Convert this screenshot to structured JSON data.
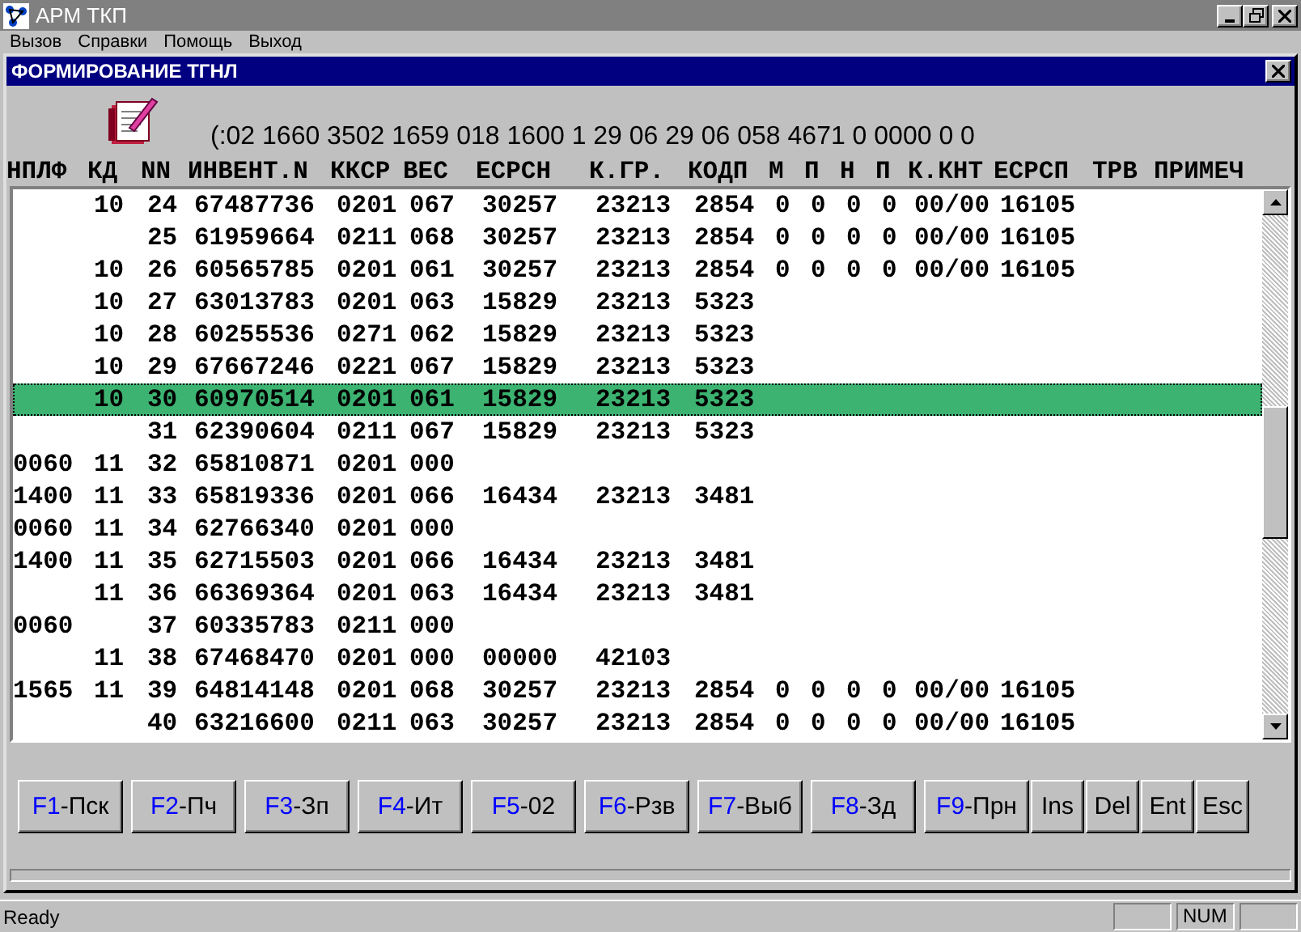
{
  "window": {
    "title": "АРМ ТКП"
  },
  "menu": [
    "Вызов",
    "Справки",
    "Помощь",
    "Выход"
  ],
  "child_window": {
    "title": "ФОРМИРОВАНИЕ ТГНЛ"
  },
  "info_line": "(:02 1660 3502 1659 018 1600 1 29 06 29 06 058 4671 0 0000 0 0",
  "table": {
    "columns": [
      "НПЛФ",
      "КД",
      "NN",
      "ИНВЕНТ.N",
      "ККСР",
      "ВЕС",
      "ЕСРСН",
      "К.ГР.",
      "КОДП",
      "М",
      "П",
      "Н",
      "П",
      "К.КНТ",
      "ЕСРСП",
      "ТРВ",
      "ПРИМЕЧ"
    ],
    "rows": [
      {
        "cells": [
          "",
          "10",
          "24",
          "67487736",
          "0201",
          "067",
          "30257",
          "23213",
          "2854",
          "0",
          "0",
          "0",
          "0",
          "00/00",
          "16105"
        ],
        "selected": false
      },
      {
        "cells": [
          "",
          "",
          "25",
          "61959664",
          "0211",
          "068",
          "30257",
          "23213",
          "2854",
          "0",
          "0",
          "0",
          "0",
          "00/00",
          "16105"
        ],
        "selected": false
      },
      {
        "cells": [
          "",
          "10",
          "26",
          "60565785",
          "0201",
          "061",
          "30257",
          "23213",
          "2854",
          "0",
          "0",
          "0",
          "0",
          "00/00",
          "16105"
        ],
        "selected": false
      },
      {
        "cells": [
          "",
          "10",
          "27",
          "63013783",
          "0201",
          "063",
          "15829",
          "23213",
          "5323"
        ],
        "selected": false
      },
      {
        "cells": [
          "",
          "10",
          "28",
          "60255536",
          "0271",
          "062",
          "15829",
          "23213",
          "5323"
        ],
        "selected": false
      },
      {
        "cells": [
          "",
          "10",
          "29",
          "67667246",
          "0221",
          "067",
          "15829",
          "23213",
          "5323"
        ],
        "selected": false
      },
      {
        "cells": [
          "",
          "10",
          "30",
          "60970514",
          "0201",
          "061",
          "15829",
          "23213",
          "5323"
        ],
        "selected": true
      },
      {
        "cells": [
          "",
          "",
          "31",
          "62390604",
          "0211",
          "067",
          "15829",
          "23213",
          "5323"
        ],
        "selected": false
      },
      {
        "cells": [
          "0060",
          "11",
          "32",
          "65810871",
          "0201",
          "000"
        ],
        "selected": false
      },
      {
        "cells": [
          "1400",
          "11",
          "33",
          "65819336",
          "0201",
          "066",
          "16434",
          "23213",
          "3481"
        ],
        "selected": false
      },
      {
        "cells": [
          "0060",
          "11",
          "34",
          "62766340",
          "0201",
          "000"
        ],
        "selected": false
      },
      {
        "cells": [
          "1400",
          "11",
          "35",
          "62715503",
          "0201",
          "066",
          "16434",
          "23213",
          "3481"
        ],
        "selected": false
      },
      {
        "cells": [
          "",
          "11",
          "36",
          "66369364",
          "0201",
          "063",
          "16434",
          "23213",
          "3481"
        ],
        "selected": false
      },
      {
        "cells": [
          "0060",
          "",
          "37",
          "60335783",
          "0211",
          "000"
        ],
        "selected": false
      },
      {
        "cells": [
          "",
          "11",
          "38",
          "67468470",
          "0201",
          "000",
          "00000",
          "42103"
        ],
        "selected": false
      },
      {
        "cells": [
          "1565",
          "11",
          "39",
          "64814148",
          "0201",
          "068",
          "30257",
          "23213",
          "2854",
          "0",
          "0",
          "0",
          "0",
          "00/00",
          "16105"
        ],
        "selected": false
      },
      {
        "cells": [
          "",
          "",
          "40",
          "63216600",
          "0211",
          "063",
          "30257",
          "23213",
          "2854",
          "0",
          "0",
          "0",
          "0",
          "00/00",
          "16105"
        ],
        "selected": false
      }
    ]
  },
  "buttons": [
    {
      "key": "F1",
      "label": "-Пск"
    },
    {
      "key": "F2",
      "label": "-Пч"
    },
    {
      "key": "F3",
      "label": "-Зп"
    },
    {
      "key": "F4",
      "label": "-Ит"
    },
    {
      "key": "F5",
      "label": "-02"
    },
    {
      "key": "F6",
      "label": "-Рзв"
    },
    {
      "key": "F7",
      "label": "-Выб"
    },
    {
      "key": "F8",
      "label": "-Зд"
    },
    {
      "key": "F9",
      "label": "-Прн"
    },
    {
      "label": "Ins"
    },
    {
      "label": "Del"
    },
    {
      "label": "Ent"
    },
    {
      "label": "Esc"
    }
  ],
  "status_bar": {
    "text": "Ready",
    "indicators": [
      "NUM"
    ]
  }
}
